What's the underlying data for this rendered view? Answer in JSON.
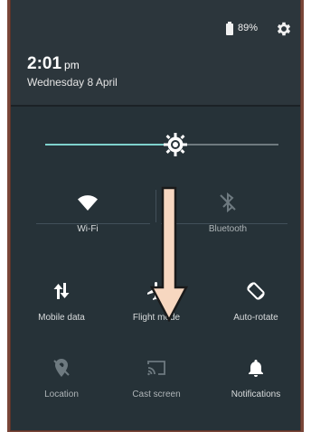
{
  "status": {
    "battery_percent": "89%",
    "time": "2:01",
    "ampm": "pm",
    "date": "Wednesday 8 April"
  },
  "brightness": {
    "level": 0.56
  },
  "tiles": [
    {
      "id": "wifi",
      "label": "Wi-Fi",
      "icon": "wifi-icon",
      "active": true
    },
    {
      "id": "bluetooth",
      "label": "Bluetooth",
      "icon": "bluetooth-icon",
      "active": false
    },
    {
      "id": "mobile-data",
      "label": "Mobile data",
      "icon": "mobile-data-icon",
      "active": true
    },
    {
      "id": "flight-mode",
      "label": "Flight mode",
      "icon": "airplane-icon",
      "active": false
    },
    {
      "id": "auto-rotate",
      "label": "Auto-rotate",
      "icon": "auto-rotate-icon",
      "active": true
    },
    {
      "id": "location",
      "label": "Location",
      "icon": "location-off-icon",
      "active": false
    },
    {
      "id": "cast-screen",
      "label": "Cast screen",
      "icon": "cast-icon",
      "active": false
    },
    {
      "id": "notifications",
      "label": "Notifications",
      "icon": "bell-icon",
      "active": true
    }
  ],
  "colors": {
    "panel_bg": "#263238",
    "header_bg": "#2c363c",
    "accent": "#7fd2cd",
    "annotation_arrow_fill": "#f7d7c0",
    "annotation_arrow_stroke": "#1a1a1a"
  }
}
